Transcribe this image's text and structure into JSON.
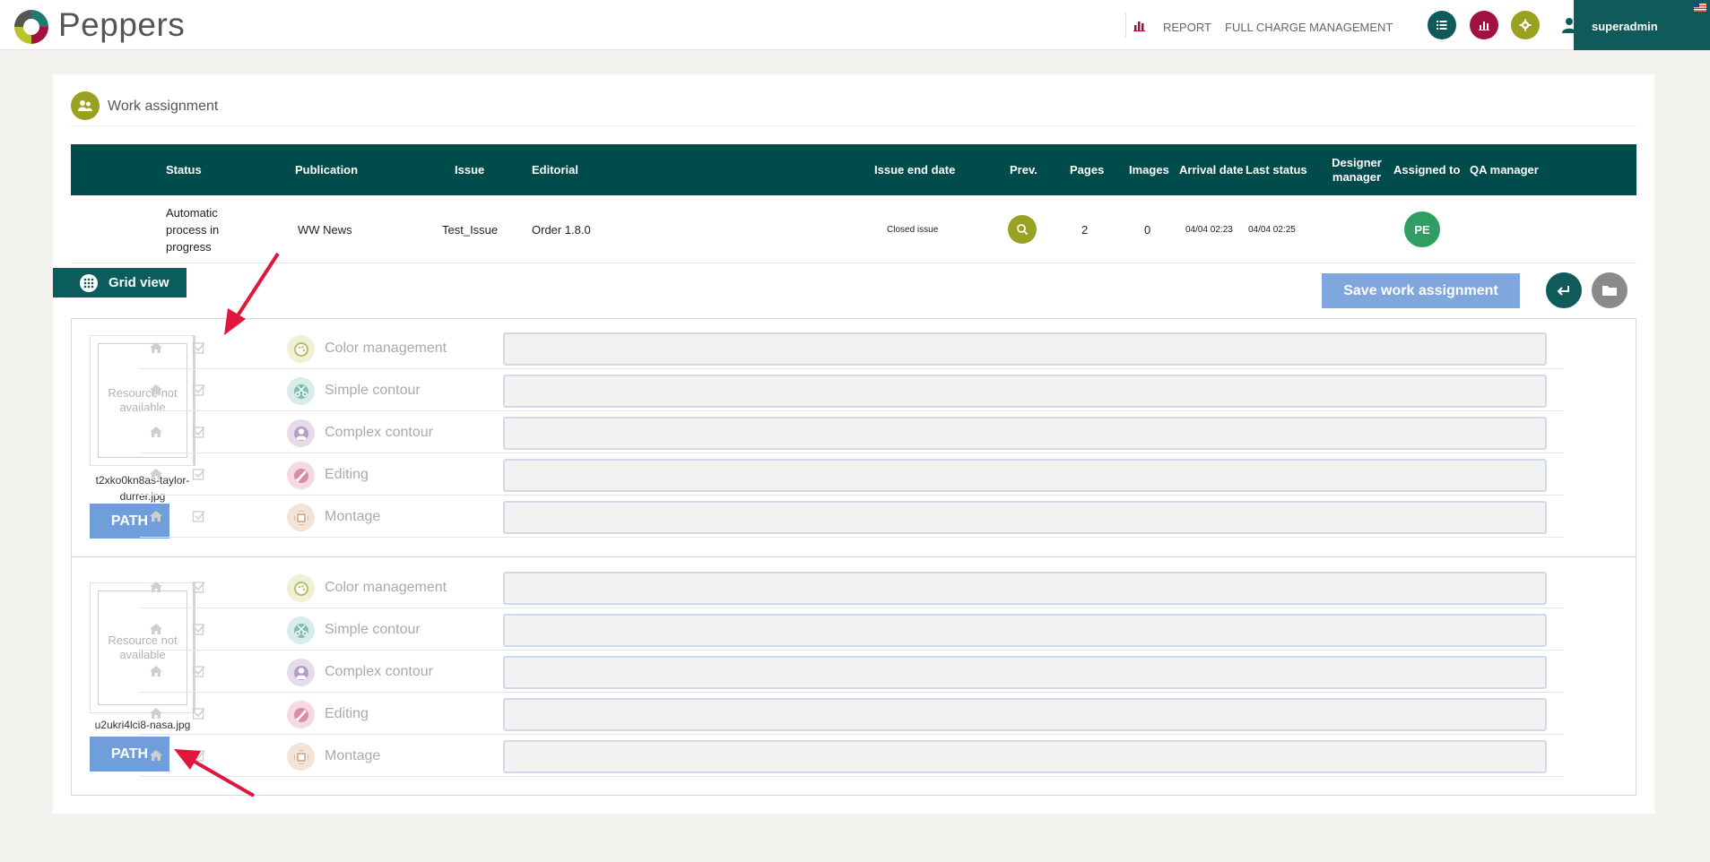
{
  "header": {
    "brand": "Peppers",
    "nav": {
      "report": "REPORT",
      "full_charge": "FULL CHARGE MANAGEMENT"
    },
    "icons": [
      "list-icon",
      "bar-chart-icon",
      "gear-icon"
    ],
    "user": "superadmin",
    "colors": {
      "teal": "#0f5a5a",
      "crimson": "#a3123e",
      "olive": "#9aa01f"
    }
  },
  "section": {
    "title": "Work assignment"
  },
  "table": {
    "headers": {
      "status": "Status",
      "publication": "Publication",
      "issue": "Issue",
      "editorial": "Editorial",
      "issue_end_date": "Issue end date",
      "prev": "Prev.",
      "pages": "Pages",
      "images": "Images",
      "arrival_date": "Arrival date",
      "last_status": "Last status",
      "designer_manager": "Designer manager",
      "assigned_to": "Assigned to",
      "qa_manager": "QA manager"
    },
    "row": {
      "status": "Automatic process in progress",
      "publication": "WW News",
      "issue": "Test_Issue",
      "editorial": "Order 1.8.0",
      "issue_end_date": "Closed issue",
      "pages": "2",
      "images": "0",
      "arrival_date": "04/04 02:23",
      "last_status": "04/04 02:25",
      "assigned_to": "PE"
    }
  },
  "toolbar": {
    "grid_view": "Grid view",
    "save": "Save work assignment"
  },
  "resources": [
    {
      "placeholder": "Resource not available",
      "filename": "t2xko0kn8as-taylor-durrer.jpg",
      "path_label": "PATH",
      "tasks": [
        "Color management",
        "Simple contour",
        "Complex contour",
        "Editing",
        "Montage"
      ]
    },
    {
      "placeholder": "Resource not available",
      "filename": "u2ukri4lci8-nasa.jpg",
      "path_label": "PATH",
      "tasks": [
        "Color management",
        "Simple contour",
        "Complex contour",
        "Editing",
        "Montage"
      ]
    }
  ]
}
